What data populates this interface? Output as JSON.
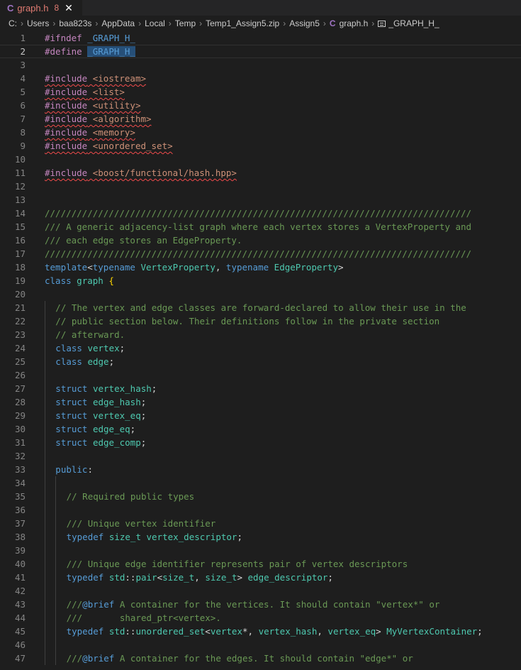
{
  "tab": {
    "icon": "C",
    "filename": "graph.h",
    "problem_count": "8",
    "close": "✕"
  },
  "breadcrumb": {
    "items": [
      "C:",
      "Users",
      "baa823s",
      "AppData",
      "Local",
      "Temp",
      "Temp1_Assign5.zip",
      "Assign5"
    ],
    "file_icon": "C",
    "file": "graph.h",
    "symbol": "_GRAPH_H_"
  },
  "editor": {
    "active_line": 2,
    "lines": [
      {
        "n": "1",
        "indent": 0,
        "tokens": [
          [
            "kw-pp",
            "#ifndef"
          ],
          [
            "pl",
            " "
          ],
          [
            "mac",
            "_GRAPH_H_"
          ]
        ]
      },
      {
        "n": "2",
        "indent": 0,
        "tokens": [
          [
            "kw-pp",
            "#define"
          ],
          [
            "pl",
            " "
          ],
          [
            "mac hl",
            "_GRAPH_H_"
          ]
        ]
      },
      {
        "n": "3",
        "indent": 0,
        "tokens": []
      },
      {
        "n": "4",
        "indent": 0,
        "tokens": [
          [
            "kw-pp squig",
            "#include"
          ],
          [
            "str squig",
            " <iostream>"
          ]
        ]
      },
      {
        "n": "5",
        "indent": 0,
        "tokens": [
          [
            "kw-pp squig",
            "#include"
          ],
          [
            "str squig",
            " <list>"
          ]
        ]
      },
      {
        "n": "6",
        "indent": 0,
        "tokens": [
          [
            "kw-pp squig",
            "#include"
          ],
          [
            "str squig",
            " <utility>"
          ]
        ]
      },
      {
        "n": "7",
        "indent": 0,
        "tokens": [
          [
            "kw-pp squig",
            "#include"
          ],
          [
            "str squig",
            " <algorithm>"
          ]
        ]
      },
      {
        "n": "8",
        "indent": 0,
        "tokens": [
          [
            "kw-pp squig",
            "#include"
          ],
          [
            "str squig",
            " <memory>"
          ]
        ]
      },
      {
        "n": "9",
        "indent": 0,
        "tokens": [
          [
            "kw-pp squig",
            "#include"
          ],
          [
            "str squig",
            " <unordered_set>"
          ]
        ]
      },
      {
        "n": "10",
        "indent": 0,
        "tokens": []
      },
      {
        "n": "11",
        "indent": 0,
        "tokens": [
          [
            "kw-pp squig",
            "#include"
          ],
          [
            "str squig",
            " <boost/functional/hash.hpp>"
          ]
        ]
      },
      {
        "n": "12",
        "indent": 0,
        "tokens": []
      },
      {
        "n": "13",
        "indent": 0,
        "tokens": []
      },
      {
        "n": "14",
        "indent": 0,
        "tokens": [
          [
            "cm",
            "////////////////////////////////////////////////////////////////////////////////"
          ]
        ]
      },
      {
        "n": "15",
        "indent": 0,
        "tokens": [
          [
            "cm",
            "/// A generic adjacency-list graph where each vertex stores a VertexProperty and"
          ]
        ]
      },
      {
        "n": "16",
        "indent": 0,
        "tokens": [
          [
            "cm",
            "/// each edge stores an EdgeProperty."
          ]
        ]
      },
      {
        "n": "17",
        "indent": 0,
        "tokens": [
          [
            "cm",
            "////////////////////////////////////////////////////////////////////////////////"
          ]
        ]
      },
      {
        "n": "18",
        "indent": 0,
        "tokens": [
          [
            "kw",
            "template"
          ],
          [
            "pl",
            "<"
          ],
          [
            "kw",
            "typename"
          ],
          [
            "pl",
            " "
          ],
          [
            "tp",
            "VertexProperty"
          ],
          [
            "pl",
            ", "
          ],
          [
            "kw",
            "typename"
          ],
          [
            "pl",
            " "
          ],
          [
            "tp",
            "EdgeProperty"
          ],
          [
            "pl",
            ">"
          ]
        ]
      },
      {
        "n": "19",
        "indent": 0,
        "tokens": [
          [
            "kw",
            "class"
          ],
          [
            "pl",
            " "
          ],
          [
            "ty",
            "graph"
          ],
          [
            "pl",
            " "
          ],
          [
            "brace",
            "{"
          ]
        ]
      },
      {
        "n": "20",
        "indent": 0,
        "tokens": []
      },
      {
        "n": "21",
        "indent": 1,
        "tokens": [
          [
            "cm",
            "// The vertex and edge classes are forward-declared to allow their use in the"
          ]
        ]
      },
      {
        "n": "22",
        "indent": 1,
        "tokens": [
          [
            "cm",
            "// public section below. Their definitions follow in the private section"
          ]
        ]
      },
      {
        "n": "23",
        "indent": 1,
        "tokens": [
          [
            "cm",
            "// afterward."
          ]
        ]
      },
      {
        "n": "24",
        "indent": 1,
        "tokens": [
          [
            "kw",
            "class"
          ],
          [
            "pl",
            " "
          ],
          [
            "ty",
            "vertex"
          ],
          [
            "pl",
            ";"
          ]
        ]
      },
      {
        "n": "25",
        "indent": 1,
        "tokens": [
          [
            "kw",
            "class"
          ],
          [
            "pl",
            " "
          ],
          [
            "ty",
            "edge"
          ],
          [
            "pl",
            ";"
          ]
        ]
      },
      {
        "n": "26",
        "indent": 1,
        "tokens": []
      },
      {
        "n": "27",
        "indent": 1,
        "tokens": [
          [
            "kw",
            "struct"
          ],
          [
            "pl",
            " "
          ],
          [
            "ty",
            "vertex_hash"
          ],
          [
            "pl",
            ";"
          ]
        ]
      },
      {
        "n": "28",
        "indent": 1,
        "tokens": [
          [
            "kw",
            "struct"
          ],
          [
            "pl",
            " "
          ],
          [
            "ty",
            "edge_hash"
          ],
          [
            "pl",
            ";"
          ]
        ]
      },
      {
        "n": "29",
        "indent": 1,
        "tokens": [
          [
            "kw",
            "struct"
          ],
          [
            "pl",
            " "
          ],
          [
            "ty",
            "vertex_eq"
          ],
          [
            "pl",
            ";"
          ]
        ]
      },
      {
        "n": "30",
        "indent": 1,
        "tokens": [
          [
            "kw",
            "struct"
          ],
          [
            "pl",
            " "
          ],
          [
            "ty",
            "edge_eq"
          ],
          [
            "pl",
            ";"
          ]
        ]
      },
      {
        "n": "31",
        "indent": 1,
        "tokens": [
          [
            "kw",
            "struct"
          ],
          [
            "pl",
            " "
          ],
          [
            "ty",
            "edge_comp"
          ],
          [
            "pl",
            ";"
          ]
        ]
      },
      {
        "n": "32",
        "indent": 1,
        "tokens": []
      },
      {
        "n": "33",
        "indent": 1,
        "tokens": [
          [
            "kw",
            "public"
          ],
          [
            "pl",
            ":"
          ]
        ]
      },
      {
        "n": "34",
        "indent": 2,
        "tokens": []
      },
      {
        "n": "35",
        "indent": 2,
        "tokens": [
          [
            "cm",
            "// Required public types"
          ]
        ]
      },
      {
        "n": "36",
        "indent": 2,
        "tokens": []
      },
      {
        "n": "37",
        "indent": 2,
        "tokens": [
          [
            "cm",
            "/// Unique vertex identifier"
          ]
        ]
      },
      {
        "n": "38",
        "indent": 2,
        "tokens": [
          [
            "kw",
            "typedef"
          ],
          [
            "pl",
            " "
          ],
          [
            "ty",
            "size_t"
          ],
          [
            "pl",
            " "
          ],
          [
            "ty",
            "vertex_descriptor"
          ],
          [
            "pl",
            ";"
          ]
        ]
      },
      {
        "n": "39",
        "indent": 2,
        "tokens": []
      },
      {
        "n": "40",
        "indent": 2,
        "tokens": [
          [
            "cm",
            "/// Unique edge identifier represents pair of vertex descriptors"
          ]
        ]
      },
      {
        "n": "41",
        "indent": 2,
        "tokens": [
          [
            "kw",
            "typedef"
          ],
          [
            "pl",
            " "
          ],
          [
            "ty",
            "std"
          ],
          [
            "pl",
            "::"
          ],
          [
            "ty",
            "pair"
          ],
          [
            "pl",
            "<"
          ],
          [
            "ty",
            "size_t"
          ],
          [
            "pl",
            ", "
          ],
          [
            "ty",
            "size_t"
          ],
          [
            "pl",
            "> "
          ],
          [
            "ty",
            "edge_descriptor"
          ],
          [
            "pl",
            ";"
          ]
        ]
      },
      {
        "n": "42",
        "indent": 2,
        "tokens": []
      },
      {
        "n": "43",
        "indent": 2,
        "tokens": [
          [
            "cm",
            "///"
          ],
          [
            "cmtag",
            "@brief"
          ],
          [
            "cm",
            " A container for the vertices. It should contain \"vertex*\" or"
          ]
        ]
      },
      {
        "n": "44",
        "indent": 2,
        "tokens": [
          [
            "cm",
            "///       shared_ptr<vertex>."
          ]
        ]
      },
      {
        "n": "45",
        "indent": 2,
        "tokens": [
          [
            "kw",
            "typedef"
          ],
          [
            "pl",
            " "
          ],
          [
            "ty",
            "std"
          ],
          [
            "pl",
            "::"
          ],
          [
            "ty",
            "unordered_set"
          ],
          [
            "pl",
            "<"
          ],
          [
            "ty",
            "vertex"
          ],
          [
            "pl",
            "*, "
          ],
          [
            "ty",
            "vertex_hash"
          ],
          [
            "pl",
            ", "
          ],
          [
            "ty",
            "vertex_eq"
          ],
          [
            "pl",
            "> "
          ],
          [
            "ty",
            "MyVertexContainer"
          ],
          [
            "pl",
            ";"
          ]
        ]
      },
      {
        "n": "46",
        "indent": 2,
        "tokens": []
      },
      {
        "n": "47",
        "indent": 2,
        "tokens": [
          [
            "cm",
            "///"
          ],
          [
            "cmtag",
            "@brief"
          ],
          [
            "cm",
            " A container for the edges. It should contain \"edge*\" or"
          ]
        ]
      }
    ]
  }
}
